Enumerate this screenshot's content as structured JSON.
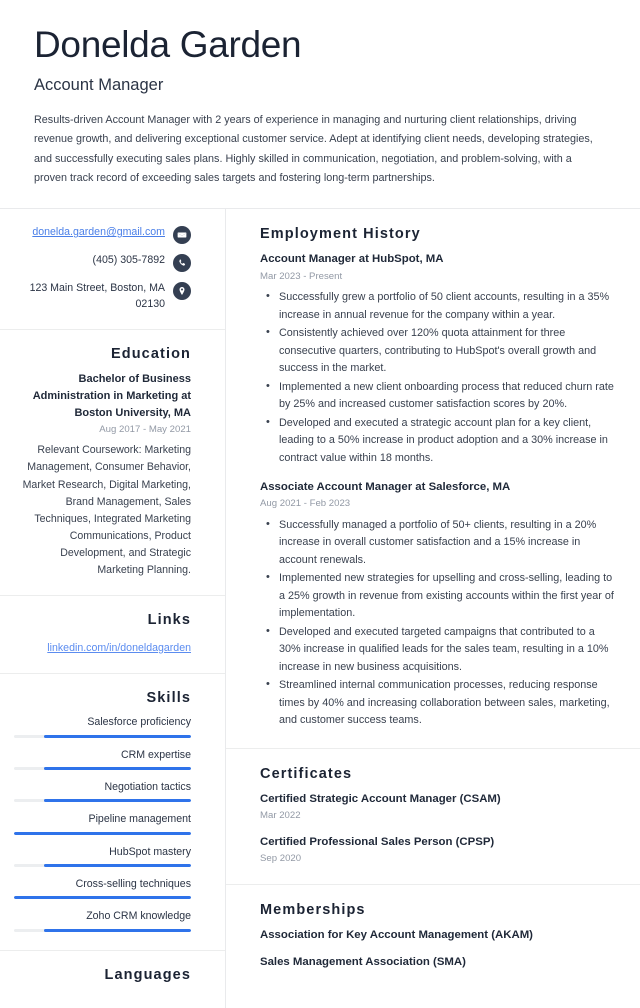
{
  "header": {
    "name": "Donelda Garden",
    "job_title": "Account Manager",
    "summary": "Results-driven Account Manager with 2 years of experience in managing and nurturing client relationships, driving revenue growth, and delivering exceptional customer service. Adept at identifying client needs, developing strategies, and successfully executing sales plans. Highly skilled in communication, negotiation, and problem-solving, with a proven track record of exceeding sales targets and fostering long-term partnerships."
  },
  "contact": {
    "email": "donelda.garden@gmail.com",
    "email_icon": "envelope-icon",
    "phone": "(405) 305-7892",
    "phone_icon": "phone-icon",
    "address": "123 Main Street, Boston, MA 02130",
    "address_icon": "location-pin-icon"
  },
  "education": {
    "section_title": "Education",
    "degree": "Bachelor of Business Administration in Marketing at Boston University, MA",
    "date": "Aug 2017 - May 2021",
    "description": "Relevant Coursework: Marketing Management, Consumer Behavior, Market Research, Digital Marketing, Brand Management, Sales Techniques, Integrated Marketing Communications, Product Development, and Strategic Marketing Planning."
  },
  "links": {
    "section_title": "Links",
    "items": [
      {
        "label": "linkedin.com/in/doneldagarden"
      }
    ]
  },
  "skills": {
    "section_title": "Skills",
    "accent_color": "#2f73ea",
    "track_color": "#eceef0",
    "items": [
      {
        "label": "Salesforce proficiency",
        "level": 83
      },
      {
        "label": "CRM expertise",
        "level": 83
      },
      {
        "label": "Negotiation tactics",
        "level": 83
      },
      {
        "label": "Pipeline management",
        "level": 100
      },
      {
        "label": "HubSpot mastery",
        "level": 83
      },
      {
        "label": "Cross-selling techniques",
        "level": 100
      },
      {
        "label": "Zoho CRM knowledge",
        "level": 83
      }
    ]
  },
  "languages": {
    "section_title": "Languages"
  },
  "employment": {
    "section_title": "Employment History",
    "entries": [
      {
        "title": "Account Manager at HubSpot, MA",
        "date": "Mar 2023 - Present",
        "bullets": [
          "Successfully grew a portfolio of 50 client accounts, resulting in a 35% increase in annual revenue for the company within a year.",
          "Consistently achieved over 120% quota attainment for three consecutive quarters, contributing to HubSpot's overall growth and success in the market.",
          "Implemented a new client onboarding process that reduced churn rate by 25% and increased customer satisfaction scores by 20%.",
          "Developed and executed a strategic account plan for a key client, leading to a 50% increase in product adoption and a 30% increase in contract value within 18 months."
        ]
      },
      {
        "title": "Associate Account Manager at Salesforce, MA",
        "date": "Aug 2021 - Feb 2023",
        "bullets": [
          "Successfully managed a portfolio of 50+ clients, resulting in a 20% increase in overall customer satisfaction and a 15% increase in account renewals.",
          "Implemented new strategies for upselling and cross-selling, leading to a 25% growth in revenue from existing accounts within the first year of implementation.",
          "Developed and executed targeted campaigns that contributed to a 30% increase in qualified leads for the sales team, resulting in a 10% increase in new business acquisitions.",
          "Streamlined internal communication processes, reducing response times by 40% and increasing collaboration between sales, marketing, and customer success teams."
        ]
      }
    ]
  },
  "certificates": {
    "section_title": "Certificates",
    "entries": [
      {
        "title": "Certified Strategic Account Manager (CSAM)",
        "date": "Mar 2022"
      },
      {
        "title": "Certified Professional Sales Person (CPSP)",
        "date": "Sep 2020"
      }
    ]
  },
  "memberships": {
    "section_title": "Memberships",
    "entries": [
      {
        "title": "Association for Key Account Management (AKAM)"
      },
      {
        "title": "Sales Management Association (SMA)"
      }
    ]
  }
}
